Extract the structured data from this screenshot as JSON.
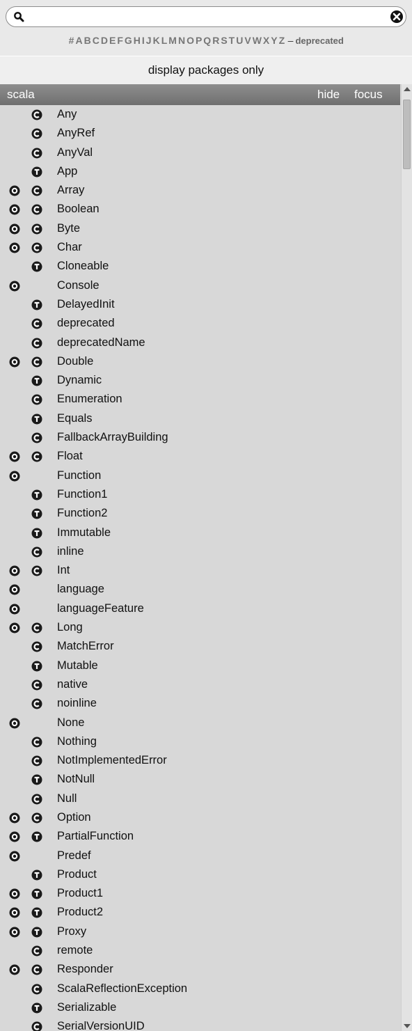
{
  "search": {
    "value": "",
    "placeholder": ""
  },
  "index_letters": [
    "#",
    "A",
    "B",
    "C",
    "D",
    "E",
    "F",
    "G",
    "H",
    "I",
    "J",
    "K",
    "L",
    "M",
    "N",
    "O",
    "P",
    "Q",
    "R",
    "S",
    "T",
    "U",
    "V",
    "W",
    "X",
    "Y",
    "Z"
  ],
  "index_dash": "–",
  "index_deprecated": "deprecated",
  "packages_only_label": "display packages only",
  "package": {
    "name": "scala",
    "hide_label": "hide",
    "focus_label": "focus"
  },
  "icons": {
    "object": "object-icon",
    "class": "class-icon",
    "trait": "trait-icon"
  },
  "entries": [
    {
      "name": "Any",
      "object": false,
      "kind": "class"
    },
    {
      "name": "AnyRef",
      "object": false,
      "kind": "class"
    },
    {
      "name": "AnyVal",
      "object": false,
      "kind": "class"
    },
    {
      "name": "App",
      "object": false,
      "kind": "trait"
    },
    {
      "name": "Array",
      "object": true,
      "kind": "class"
    },
    {
      "name": "Boolean",
      "object": true,
      "kind": "class"
    },
    {
      "name": "Byte",
      "object": true,
      "kind": "class"
    },
    {
      "name": "Char",
      "object": true,
      "kind": "class"
    },
    {
      "name": "Cloneable",
      "object": false,
      "kind": "trait"
    },
    {
      "name": "Console",
      "object": true,
      "kind": null
    },
    {
      "name": "DelayedInit",
      "object": false,
      "kind": "trait"
    },
    {
      "name": "deprecated",
      "object": false,
      "kind": "class"
    },
    {
      "name": "deprecatedName",
      "object": false,
      "kind": "class"
    },
    {
      "name": "Double",
      "object": true,
      "kind": "class"
    },
    {
      "name": "Dynamic",
      "object": false,
      "kind": "trait"
    },
    {
      "name": "Enumeration",
      "object": false,
      "kind": "class"
    },
    {
      "name": "Equals",
      "object": false,
      "kind": "trait"
    },
    {
      "name": "FallbackArrayBuilding",
      "object": false,
      "kind": "class"
    },
    {
      "name": "Float",
      "object": true,
      "kind": "class"
    },
    {
      "name": "Function",
      "object": true,
      "kind": null
    },
    {
      "name": "Function1",
      "object": false,
      "kind": "trait"
    },
    {
      "name": "Function2",
      "object": false,
      "kind": "trait"
    },
    {
      "name": "Immutable",
      "object": false,
      "kind": "trait"
    },
    {
      "name": "inline",
      "object": false,
      "kind": "class"
    },
    {
      "name": "Int",
      "object": true,
      "kind": "class"
    },
    {
      "name": "language",
      "object": true,
      "kind": null
    },
    {
      "name": "languageFeature",
      "object": true,
      "kind": null
    },
    {
      "name": "Long",
      "object": true,
      "kind": "class"
    },
    {
      "name": "MatchError",
      "object": false,
      "kind": "class"
    },
    {
      "name": "Mutable",
      "object": false,
      "kind": "trait"
    },
    {
      "name": "native",
      "object": false,
      "kind": "class"
    },
    {
      "name": "noinline",
      "object": false,
      "kind": "class"
    },
    {
      "name": "None",
      "object": true,
      "kind": null
    },
    {
      "name": "Nothing",
      "object": false,
      "kind": "class"
    },
    {
      "name": "NotImplementedError",
      "object": false,
      "kind": "class"
    },
    {
      "name": "NotNull",
      "object": false,
      "kind": "trait"
    },
    {
      "name": "Null",
      "object": false,
      "kind": "class"
    },
    {
      "name": "Option",
      "object": true,
      "kind": "class"
    },
    {
      "name": "PartialFunction",
      "object": true,
      "kind": "trait"
    },
    {
      "name": "Predef",
      "object": true,
      "kind": null
    },
    {
      "name": "Product",
      "object": false,
      "kind": "trait"
    },
    {
      "name": "Product1",
      "object": true,
      "kind": "trait"
    },
    {
      "name": "Product2",
      "object": true,
      "kind": "trait"
    },
    {
      "name": "Proxy",
      "object": true,
      "kind": "trait"
    },
    {
      "name": "remote",
      "object": false,
      "kind": "class"
    },
    {
      "name": "Responder",
      "object": true,
      "kind": "class"
    },
    {
      "name": "ScalaReflectionException",
      "object": false,
      "kind": "class"
    },
    {
      "name": "Serializable",
      "object": false,
      "kind": "trait"
    },
    {
      "name": "SerialVersionUID",
      "object": false,
      "kind": "class"
    }
  ]
}
